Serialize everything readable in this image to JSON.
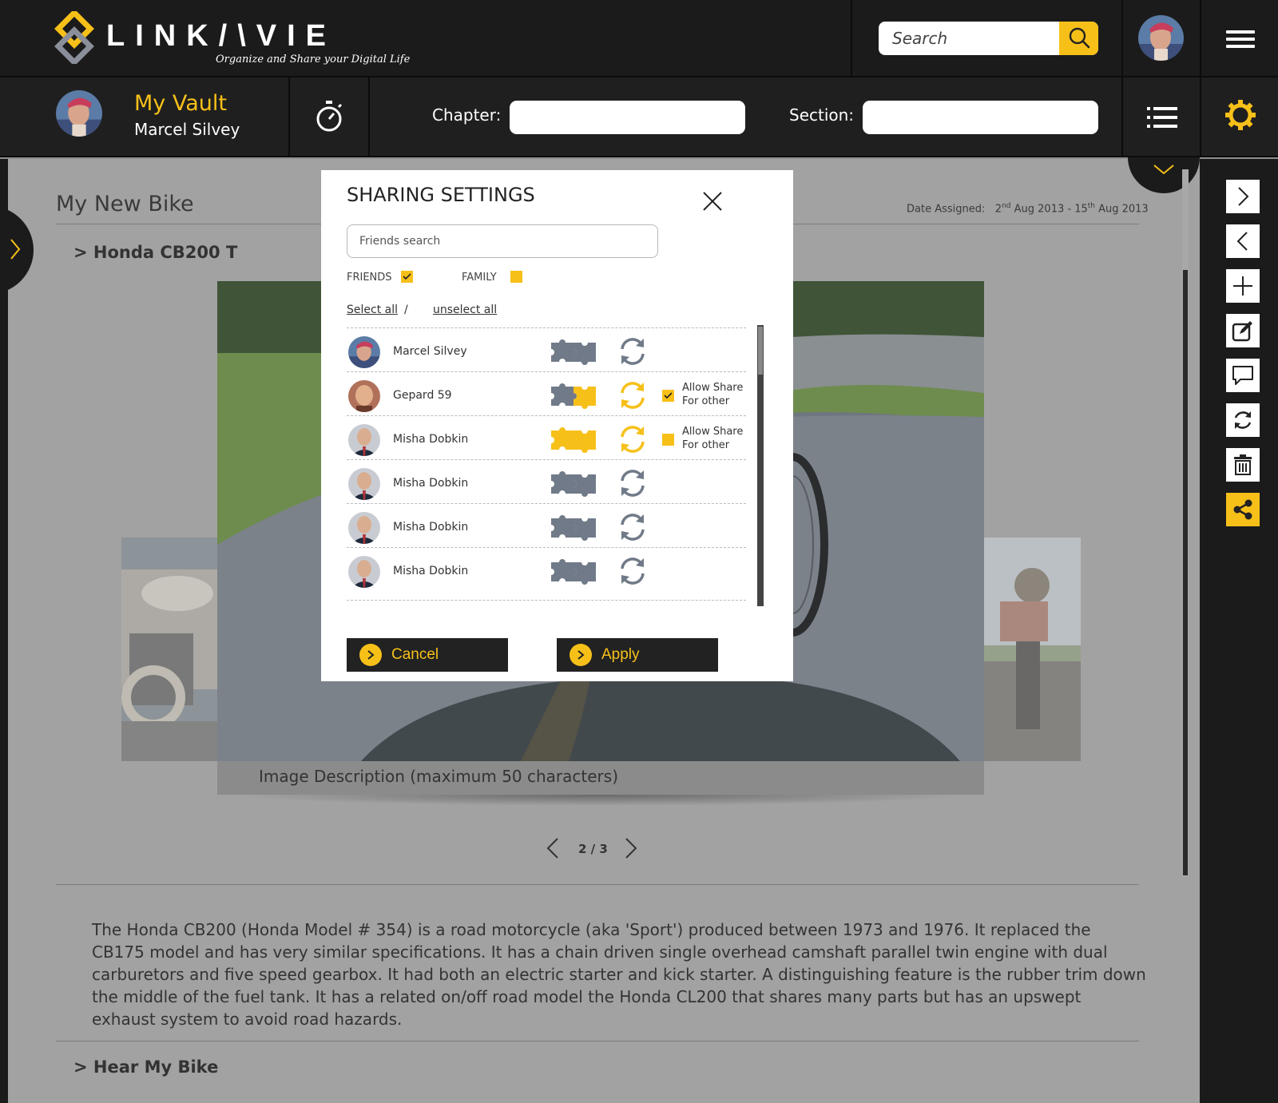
{
  "brand": {
    "name_part1": "LINK",
    "name_part2": "VIE",
    "tagline": "Organize and Share your Digital Life"
  },
  "header": {
    "search_placeholder": "Search"
  },
  "subbar": {
    "vault_title": "My Vault",
    "user_name": "Marcel Silvey",
    "chapter_label": "Chapter:",
    "chapter_value": "",
    "section_label": "Section:",
    "section_value": ""
  },
  "page": {
    "title": "My New Bike",
    "date_label": "Date Assigned:",
    "date_start_day": "2",
    "date_start_sup": "nd",
    "date_start_rest": " Aug 2013 - 15",
    "date_end_sup": "th",
    "date_end_rest": " Aug 2013",
    "section_heading": "> Honda CB200 T",
    "image_caption": "Image Description (maximum 50 characters)",
    "pager": "2 / 3",
    "description": "The Honda CB200 (Honda Model # 354) is a road motorcycle (aka 'Sport') produced between 1973 and 1976. It replaced the CB175 model and has very similar specifications. It has a chain driven single overhead camshaft parallel twin engine with dual carburetors and five speed gearbox. It had both an electric starter and kick starter. A distinguishing feature is the rubber trim down the middle of the fuel tank. It has a related on/off road model the Honda CL200 that shares many parts but has an upswept exhaust system to avoid road hazards.",
    "bottom_heading": "> Hear My Bike"
  },
  "toolbar": {
    "items": [
      "chevron-right-icon",
      "chevron-left-icon",
      "plus-icon",
      "edit-icon",
      "comment-icon",
      "sync-icon",
      "trash-icon",
      "share-icon"
    ],
    "active": "share-icon"
  },
  "modal": {
    "title": "SHARING SETTINGS",
    "search_placeholder": "Friends search",
    "friends_label": "FRIENDS",
    "friends_checked": true,
    "family_label": "FAMILY",
    "family_checked": false,
    "select_all": "Select all",
    "separator": "/",
    "unselect_all": "unselect all",
    "allow_line1": "Allow Share",
    "allow_line2": "For other",
    "people": [
      {
        "name": "Marcel Silvey",
        "puzzle": "gray",
        "sync": "gray",
        "allow": null
      },
      {
        "name": "Gepard 59",
        "puzzle": "half",
        "sync": "yellow",
        "allow": true
      },
      {
        "name": "Misha Dobkin",
        "puzzle": "yellow",
        "sync": "yellow",
        "allow": false
      },
      {
        "name": "Misha Dobkin",
        "puzzle": "gray",
        "sync": "gray",
        "allow": null
      },
      {
        "name": "Misha Dobkin",
        "puzzle": "gray",
        "sync": "gray",
        "allow": null
      },
      {
        "name": "Misha Dobkin",
        "puzzle": "gray",
        "sync": "gray",
        "allow": null
      }
    ],
    "cancel_label": "Cancel",
    "apply_label": "Apply"
  },
  "colors": {
    "accent": "#f7c019",
    "dark": "#1b1b1b",
    "puzzle_gray": "#707a88"
  }
}
